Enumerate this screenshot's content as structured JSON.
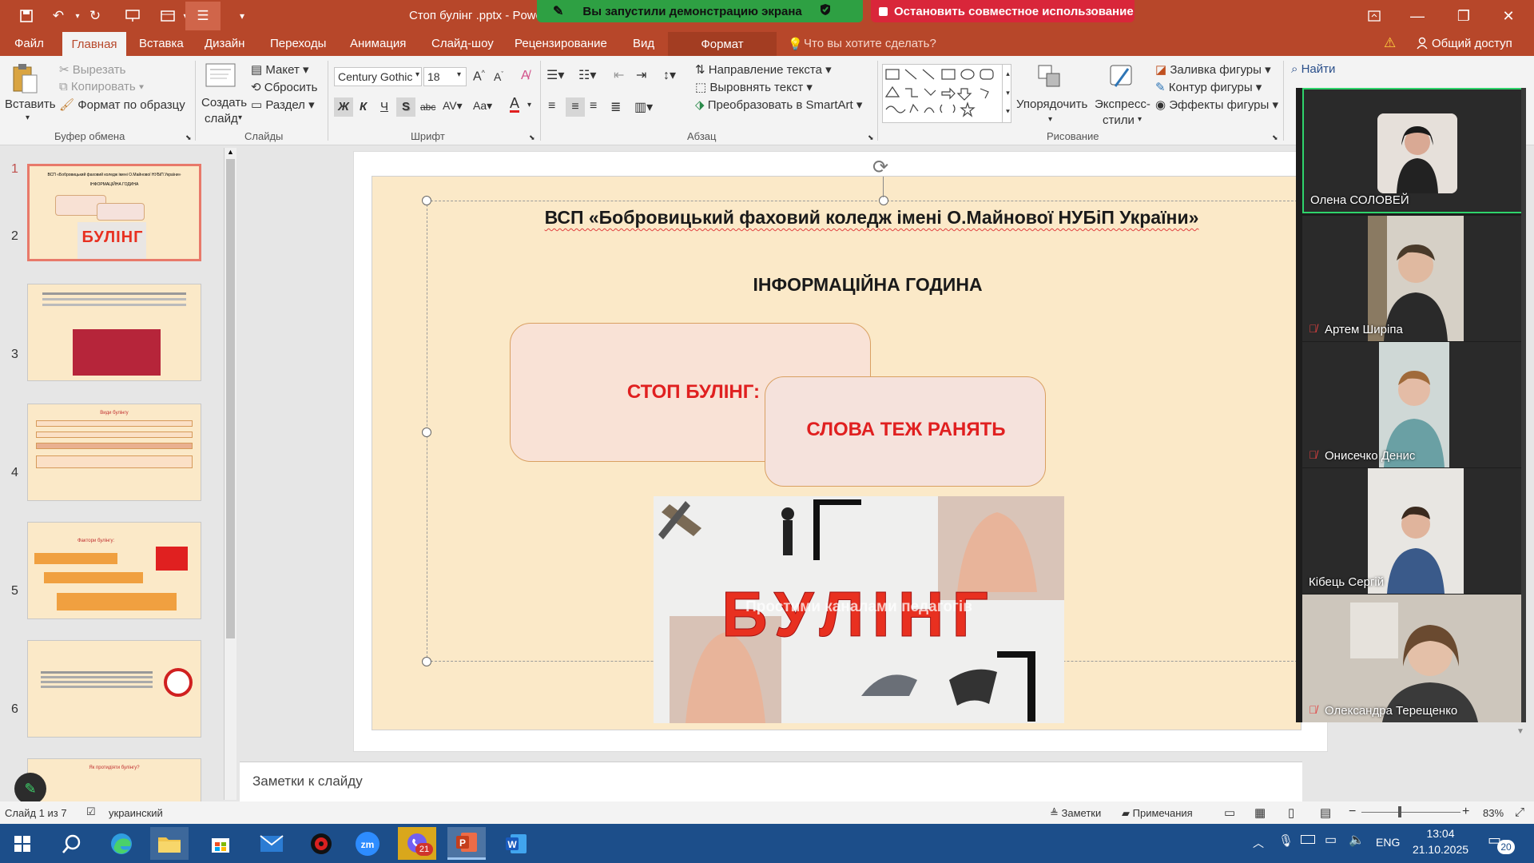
{
  "window": {
    "doc_title": "Стоп булінг .pptx - Powe",
    "share_banner": "Вы запустили демонстрацию экрана",
    "stop_share": "Остановить совместное использование"
  },
  "tabs": {
    "file": "Файл",
    "home": "Главная",
    "insert": "Вставка",
    "design": "Дизайн",
    "transitions": "Переходы",
    "animation": "Анимация",
    "slideshow": "Слайд-шоу",
    "review": "Рецензирование",
    "view": "Вид",
    "format": "Формат",
    "tell_me": "Что вы хотите сделать?",
    "share": "Общий доступ"
  },
  "ribbon": {
    "paste": "Вставить",
    "cut": "Вырезать",
    "copy": "Копировать",
    "format_painter": "Формат по образцу",
    "clipboard_group": "Буфер обмена",
    "new_slide_1": "Создать",
    "new_slide_2": "слайд",
    "layout": "Макет",
    "reset": "Сбросить",
    "section": "Раздел",
    "slides_group": "Слайды",
    "font_name": "Century Gothic",
    "font_size": "18",
    "font_group": "Шрифт",
    "text_direction": "Направление текста",
    "align_text": "Выровнять текст",
    "smartart": "Преобразовать в SmartArt",
    "paragraph_group": "Абзац",
    "arrange": "Упорядочить",
    "quick_styles_1": "Экспресс-",
    "quick_styles_2": "стили",
    "shape_fill": "Заливка фигуры",
    "shape_outline": "Контур фигуры",
    "shape_effects": "Эффекты фигуры",
    "drawing_group": "Рисование",
    "find": "Найти"
  },
  "thumbnails": {
    "nums": [
      "1",
      "2",
      "3",
      "4",
      "5",
      "6"
    ],
    "t1_title": "ВСП «Бобровицький фаховий коледж імені О.Майнової НУБіП України»",
    "t1_sub": "ІНФОРМАЦІЙНА ГОДИНА",
    "t1_word": "БУЛІНГ",
    "t3_title": "Види булінгу",
    "t4_title": "Фактори булінгу:",
    "t6_title": "Як протидіяти булінгу?"
  },
  "slide": {
    "org": "ВСП «Бобровицький фаховий коледж імені О.Майнової НУБіП України»",
    "subtitle": "ІНФОРМАЦІЙНА ГОДИНА",
    "box1": "СТОП БУЛІНГ:",
    "box2": "СЛОВА ТЕЖ РАНЯТЬ",
    "image_word": "БУЛІНГ",
    "image_overlay": "Простими каналами   педагогів"
  },
  "notes": {
    "placeholder": "Заметки к слайду"
  },
  "status": {
    "slide_counter": "Слайд 1 из 7",
    "language": "украинский",
    "notes_btn": "Заметки",
    "comments_btn": "Примечания",
    "zoom": "83%"
  },
  "participants": [
    {
      "name": "Олена СОЛОВЕЙ",
      "muted": false
    },
    {
      "name": "Артем Ширіпа",
      "muted": true
    },
    {
      "name": "Онисечко Денис",
      "muted": true
    },
    {
      "name": "Кібець Сергій",
      "muted": false
    },
    {
      "name": "Олександра Терещенко",
      "muted": true
    }
  ],
  "taskbar": {
    "viber_badge": "21",
    "lang": "ENG",
    "time": "13:04",
    "date": "21.10.2025",
    "notif_count": "20"
  },
  "colors": {
    "ppt_accent": "#b7472a",
    "slide_bg": "#fbe9c8",
    "title_red": "#e02020",
    "zoom_active": "#2fd36b"
  }
}
